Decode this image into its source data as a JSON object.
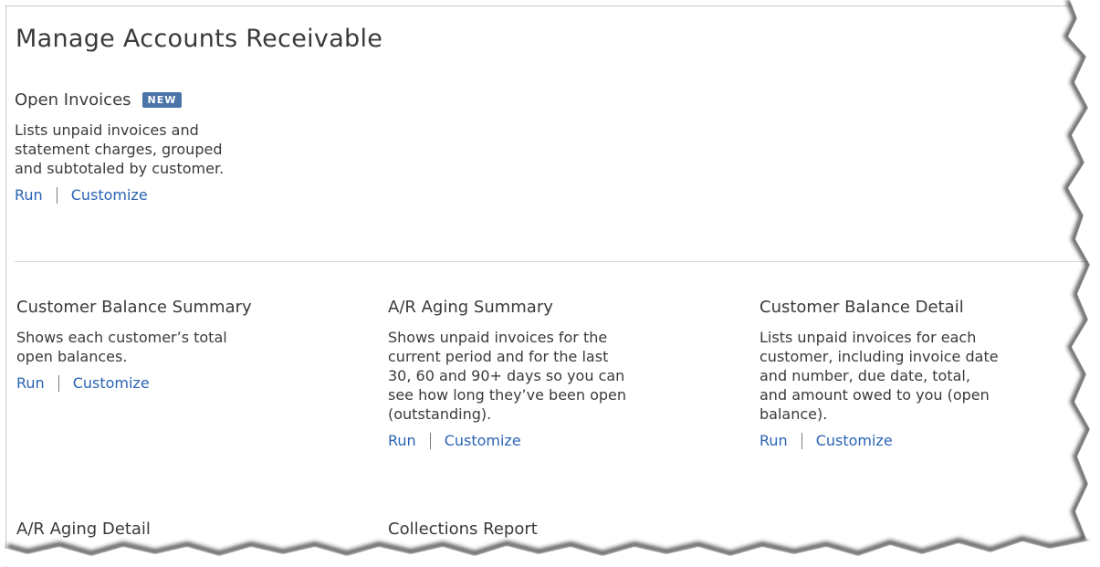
{
  "page": {
    "title": "Manage Accounts Receivable"
  },
  "badge_new": "NEW",
  "reports": [
    {
      "title": "Open Invoices",
      "description": [
        "Lists unpaid invoices and",
        "statement charges, grouped",
        "and subtotaled by customer."
      ],
      "run_label": "Run",
      "customize_label": "Customize"
    },
    {
      "title": "Customer Balance Summary",
      "description": [
        "Shows each customer’s total",
        "open balances."
      ],
      "run_label": "Run",
      "customize_label": "Customize"
    },
    {
      "title": "A/R Aging Summary",
      "description": [
        "Shows unpaid invoices for the",
        "current period and for the last",
        "30, 60 and 90+ days so you can",
        "see how long they’ve been open",
        "(outstanding)."
      ],
      "run_label": "Run",
      "customize_label": "Customize"
    },
    {
      "title": "Customer Balance Detail",
      "description": [
        "Lists unpaid invoices for each",
        "customer, including invoice date",
        "and number, due date, total,",
        "and amount owed to you (open",
        "balance)."
      ],
      "run_label": "Run",
      "customize_label": "Customize"
    },
    {
      "title": "A/R Aging Detail"
    },
    {
      "title": "Collections Report"
    }
  ]
}
